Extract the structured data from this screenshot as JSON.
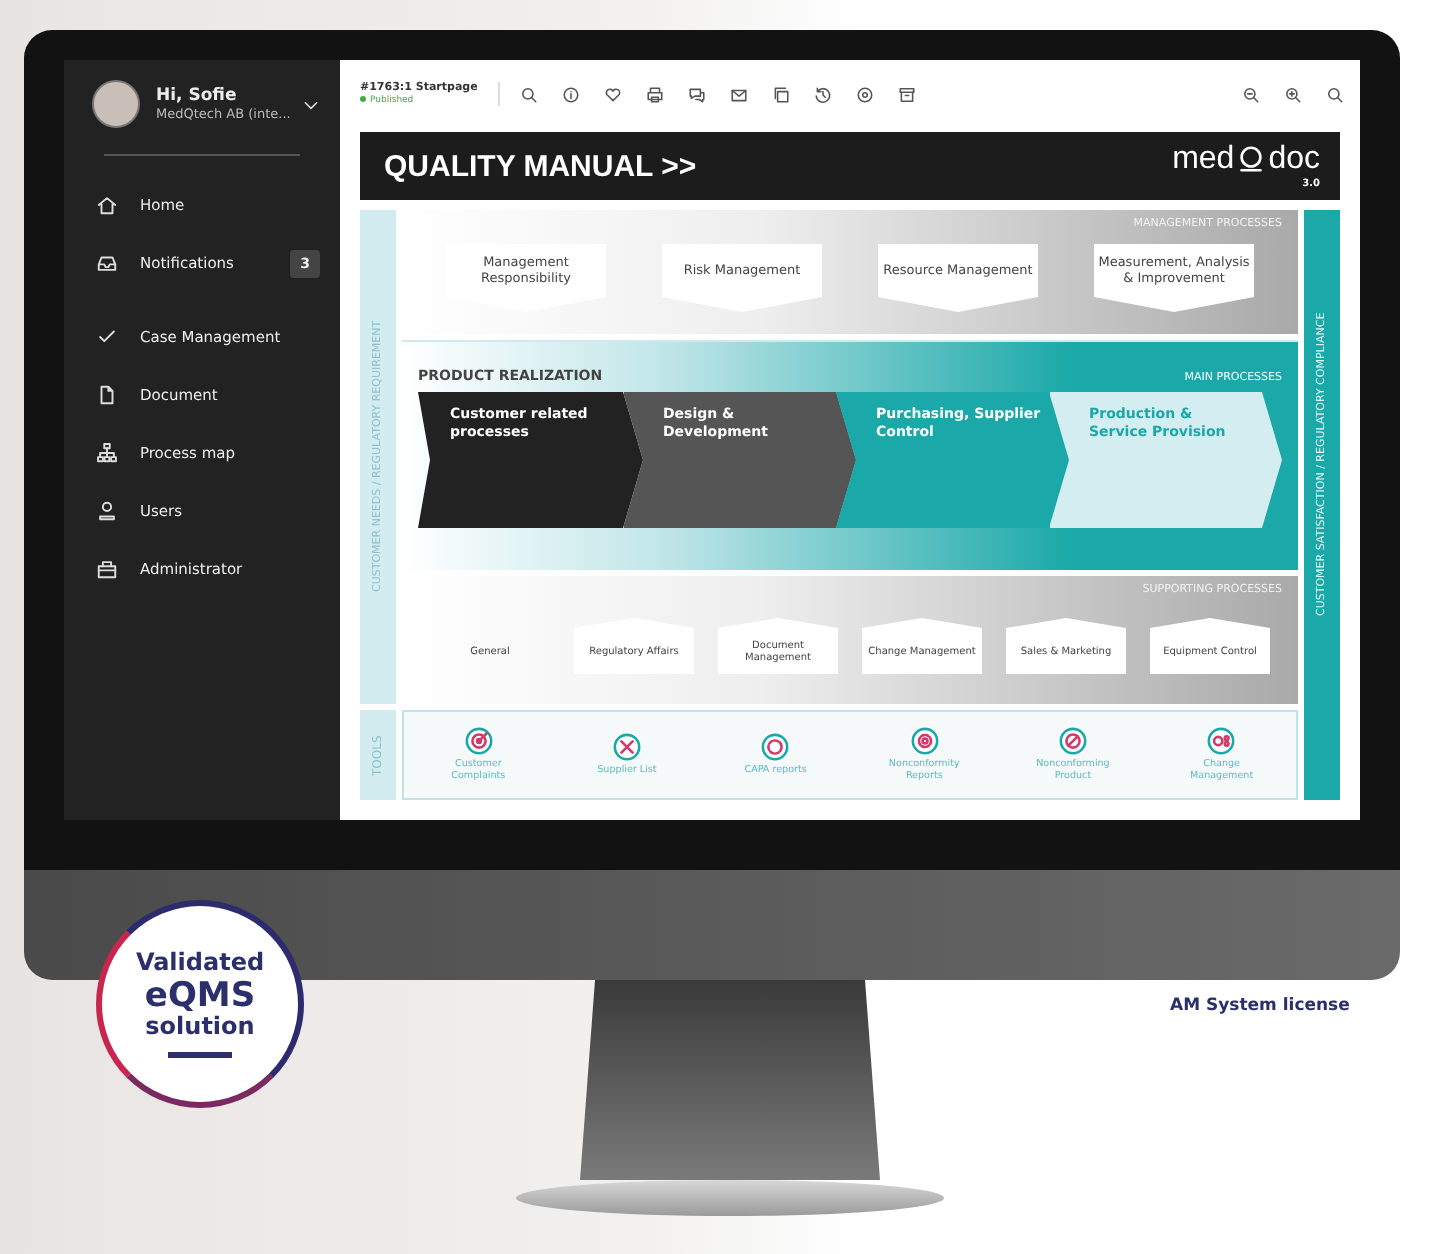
{
  "sidebar": {
    "user": {
      "greeting": "Hi, Sofie",
      "org": "MedQtech AB (inte..."
    },
    "nav_groups": [
      {
        "items": [
          {
            "label": "Home",
            "selected": false
          },
          {
            "label": "Notifications",
            "selected": false,
            "badge": "3"
          }
        ]
      },
      {
        "items": [
          {
            "label": "Case Management",
            "selected": false
          },
          {
            "label": "Document",
            "selected": false
          },
          {
            "label": "Process map",
            "selected": false
          },
          {
            "label": "Users",
            "selected": false
          },
          {
            "label": "Administrator",
            "selected": false
          }
        ]
      }
    ]
  },
  "toolbar": {
    "page_title": "#1763:1 Startpage",
    "status": "Published"
  },
  "banner": {
    "title": "QUALITY MANUAL >>",
    "logo_left": "med",
    "logo_right": "doc",
    "version": "3.0"
  },
  "process_map": {
    "left_label": "CUSTOMER NEEDS / REGULATORY REQUIREMENT",
    "right_label": "CUSTOMER SATISFACTION / REGULATORY COMPLIANCE",
    "management": {
      "heading": "MANAGEMENT PROCESSES",
      "items": [
        "Management Responsibility",
        "Risk Management",
        "Resource Management",
        "Measurement, Analysis & Improvement"
      ]
    },
    "main": {
      "title": "PRODUCT REALIZATION",
      "heading": "MAIN PROCESSES",
      "steps": [
        {
          "label": "Customer related processes",
          "color": "#222222"
        },
        {
          "label": "Design & Development",
          "color": "#555555"
        },
        {
          "label": "Purchasing, Supplier Control",
          "color": "#1aa8a8"
        },
        {
          "label": "Production & Service Provision",
          "color": "#d4edf0"
        }
      ]
    },
    "supporting": {
      "heading": "SUPPORTING PROCESSES",
      "items": [
        "General",
        "Regulatory Affairs",
        "Document Management",
        "Change Management",
        "Sales & Marketing",
        "Equipment Control"
      ]
    },
    "tools": {
      "label": "TOOLS",
      "items": [
        "Customer Complaints",
        "Supplier List",
        "CAPA reports",
        "Nonconformity Reports",
        "Nonconforming Product",
        "Change Management"
      ]
    }
  },
  "badge": {
    "lines": [
      "Validated",
      "eQMS",
      "solution"
    ]
  },
  "license": "AM System license"
}
